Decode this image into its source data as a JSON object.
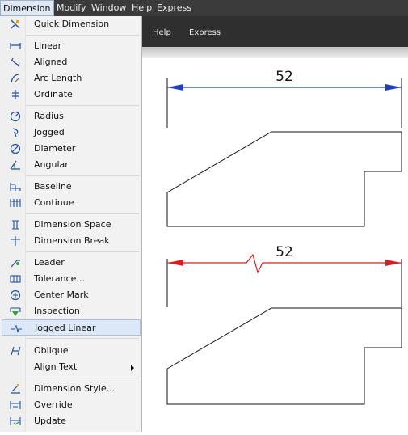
{
  "menubar": {
    "items": [
      {
        "label": "Dimension"
      },
      {
        "label": "Modify"
      },
      {
        "label": "Window"
      },
      {
        "label": "Help"
      },
      {
        "label": "Express"
      }
    ]
  },
  "ribbon": {
    "items": [
      {
        "label": "Help"
      },
      {
        "label": "Express"
      }
    ]
  },
  "menu": {
    "items": [
      {
        "label": "Quick Dimension",
        "icon": "quick-dimension-icon"
      },
      {
        "label": "Linear",
        "icon": "linear-icon"
      },
      {
        "label": "Aligned",
        "icon": "aligned-icon"
      },
      {
        "label": "Arc Length",
        "icon": "arc-length-icon"
      },
      {
        "label": "Ordinate",
        "icon": "ordinate-icon"
      },
      {
        "label": "Radius",
        "icon": "radius-icon"
      },
      {
        "label": "Jogged",
        "icon": "jogged-icon"
      },
      {
        "label": "Diameter",
        "icon": "diameter-icon"
      },
      {
        "label": "Angular",
        "icon": "angular-icon"
      },
      {
        "label": "Baseline",
        "icon": "baseline-icon"
      },
      {
        "label": "Continue",
        "icon": "continue-icon"
      },
      {
        "label": "Dimension Space",
        "icon": "dimension-space-icon"
      },
      {
        "label": "Dimension Break",
        "icon": "dimension-break-icon"
      },
      {
        "label": "Leader",
        "icon": "leader-icon"
      },
      {
        "label": "Tolerance...",
        "icon": "tolerance-icon"
      },
      {
        "label": "Center Mark",
        "icon": "center-mark-icon"
      },
      {
        "label": "Inspection",
        "icon": "inspection-icon"
      },
      {
        "label": "Jogged Linear",
        "icon": "jogged-linear-icon",
        "highlighted": true
      },
      {
        "label": "Oblique",
        "icon": "oblique-icon"
      },
      {
        "label": "Align Text",
        "icon": "",
        "submenu": true
      },
      {
        "label": "Dimension Style...",
        "icon": "dimension-style-icon"
      },
      {
        "label": "Override",
        "icon": "override-icon"
      },
      {
        "label": "Update",
        "icon": "update-icon"
      }
    ]
  },
  "drawing": {
    "top_dimension": {
      "text": "52",
      "color": "#1f3fbf"
    },
    "bottom_dimension": {
      "text": "52",
      "color": "#d42020"
    }
  }
}
